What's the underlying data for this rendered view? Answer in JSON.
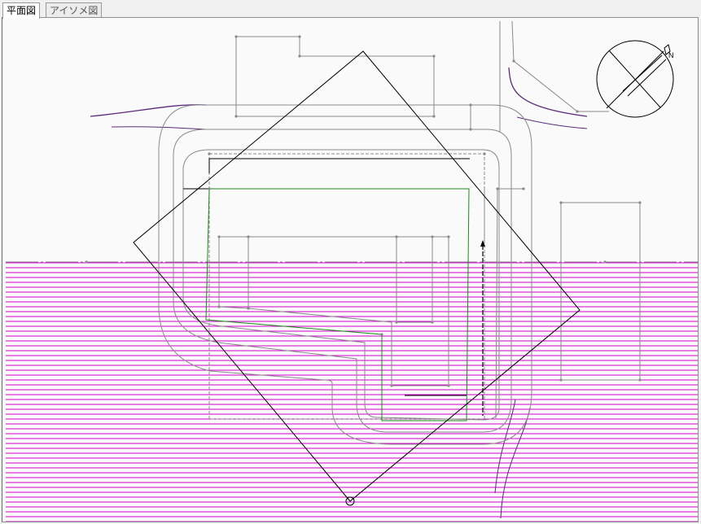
{
  "tabs": [
    {
      "label": "平面図",
      "active": true
    },
    {
      "label": "アイソメ図",
      "active": false
    }
  ],
  "colors": {
    "background": "#fafafa",
    "hatch": "#d000d0",
    "gray_line": "#8a8a8a",
    "black_line": "#000000",
    "green_line": "#1a8a1a",
    "purple_line": "#5a2a7a"
  },
  "compass": {
    "symbol": "N"
  }
}
